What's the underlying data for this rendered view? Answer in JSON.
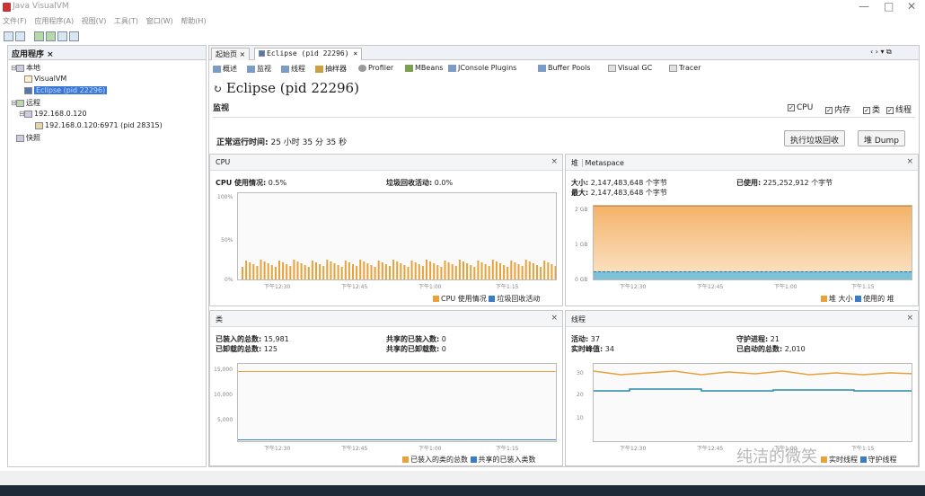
{
  "window": {
    "title": "Java VisualVM",
    "min": "—",
    "max": "□",
    "close": "✕"
  },
  "menu": [
    "文件(F)",
    "应用程序(A)",
    "视图(V)",
    "工具(T)",
    "窗口(W)",
    "帮助(H)"
  ],
  "left": {
    "title": "应用程序 ×",
    "local": "本地",
    "visualvm": "VisualVM",
    "eclipse": "Eclipse (pid 22296)",
    "remote": "远程",
    "host": "192.168.0.120",
    "remote_proc": "192.168.0.120:6971 (pid 28315)",
    "snapshots": "快照"
  },
  "tabs": {
    "start": "起始页",
    "eclipse": "Eclipse (pid 22296)"
  },
  "subtabs": [
    "概述",
    "监视",
    "线程",
    "抽样器",
    "Profiler",
    "MBeans",
    "JConsole Plugins",
    "Buffer Pools",
    "Visual GC",
    "Tracer"
  ],
  "page_title": "Eclipse (pid 22296)",
  "monitor": {
    "label": "监视",
    "checks": [
      "CPU",
      "内存",
      "类",
      "线程"
    ],
    "uptime_label": "正常运行时间:",
    "uptime_value": "25 小时 35 分 35 秒",
    "gc_button": "执行垃圾回收",
    "dump_button": "堆 Dump"
  },
  "cpu": {
    "title": "CPU",
    "usage_label": "CPU 使用情况:",
    "usage_value": "0.5%",
    "gc_label": "垃圾回收活动:",
    "gc_value": "0.0%",
    "y_ticks": [
      "100%",
      "50%",
      "0%"
    ],
    "x_ticks": [
      "下午12:30",
      "下午12:45",
      "下午1:00",
      "下午1:15"
    ],
    "legend": [
      "CPU 使用情况",
      "垃圾回收活动"
    ],
    "color_cpu": "#e8a23a",
    "color_gc": "#3a7dc4"
  },
  "heap": {
    "tabs": [
      "堆",
      "Metaspace"
    ],
    "size_label": "大小:",
    "size_value": "2,147,483,648 个字节",
    "max_label": "最大:",
    "max_value": "2,147,483,648 个字节",
    "used_label": "已使用:",
    "used_value": "225,252,912 个字节",
    "y_ticks": [
      "2 GB",
      "1 GB",
      "0 GB"
    ],
    "x_ticks": [
      "下午12:30",
      "下午12:45",
      "下午1:00",
      "下午1:15"
    ],
    "legend": [
      "堆 大小",
      "使用的 堆"
    ],
    "size_fraction": 1.0,
    "used_fraction": 0.105
  },
  "classes": {
    "title": "类",
    "loaded_label": "已装入的总数:",
    "loaded_value": "15,981",
    "unloaded_label": "已卸载的总数:",
    "unloaded_value": "125",
    "shared_loaded_label": "共享的已装入数:",
    "shared_loaded_value": "0",
    "shared_unloaded_label": "共享的已卸载数:",
    "shared_unloaded_value": "0",
    "y_ticks": [
      "15,000",
      "10,000",
      "5,000"
    ],
    "x_ticks": [
      "下午12:30",
      "下午12:45",
      "下午1:00",
      "下午1:15"
    ],
    "legend": [
      "已装入的类的总数",
      "共享的已装入类数"
    ]
  },
  "threads": {
    "title": "线程",
    "live_label": "活动:",
    "live_value": "37",
    "peak_label": "实时峰值:",
    "peak_value": "34",
    "daemon_label": "守护进程:",
    "daemon_value": "21",
    "started_label": "已启动的总数:",
    "started_value": "2,010",
    "y_ticks": [
      "30",
      "20",
      "10"
    ],
    "x_ticks": [
      "下午12:30",
      "下午12:45",
      "下午1:00",
      "下午1:15"
    ],
    "legend": [
      "实时线程",
      "守护线程"
    ]
  },
  "watermark": "纯洁的微笑"
}
